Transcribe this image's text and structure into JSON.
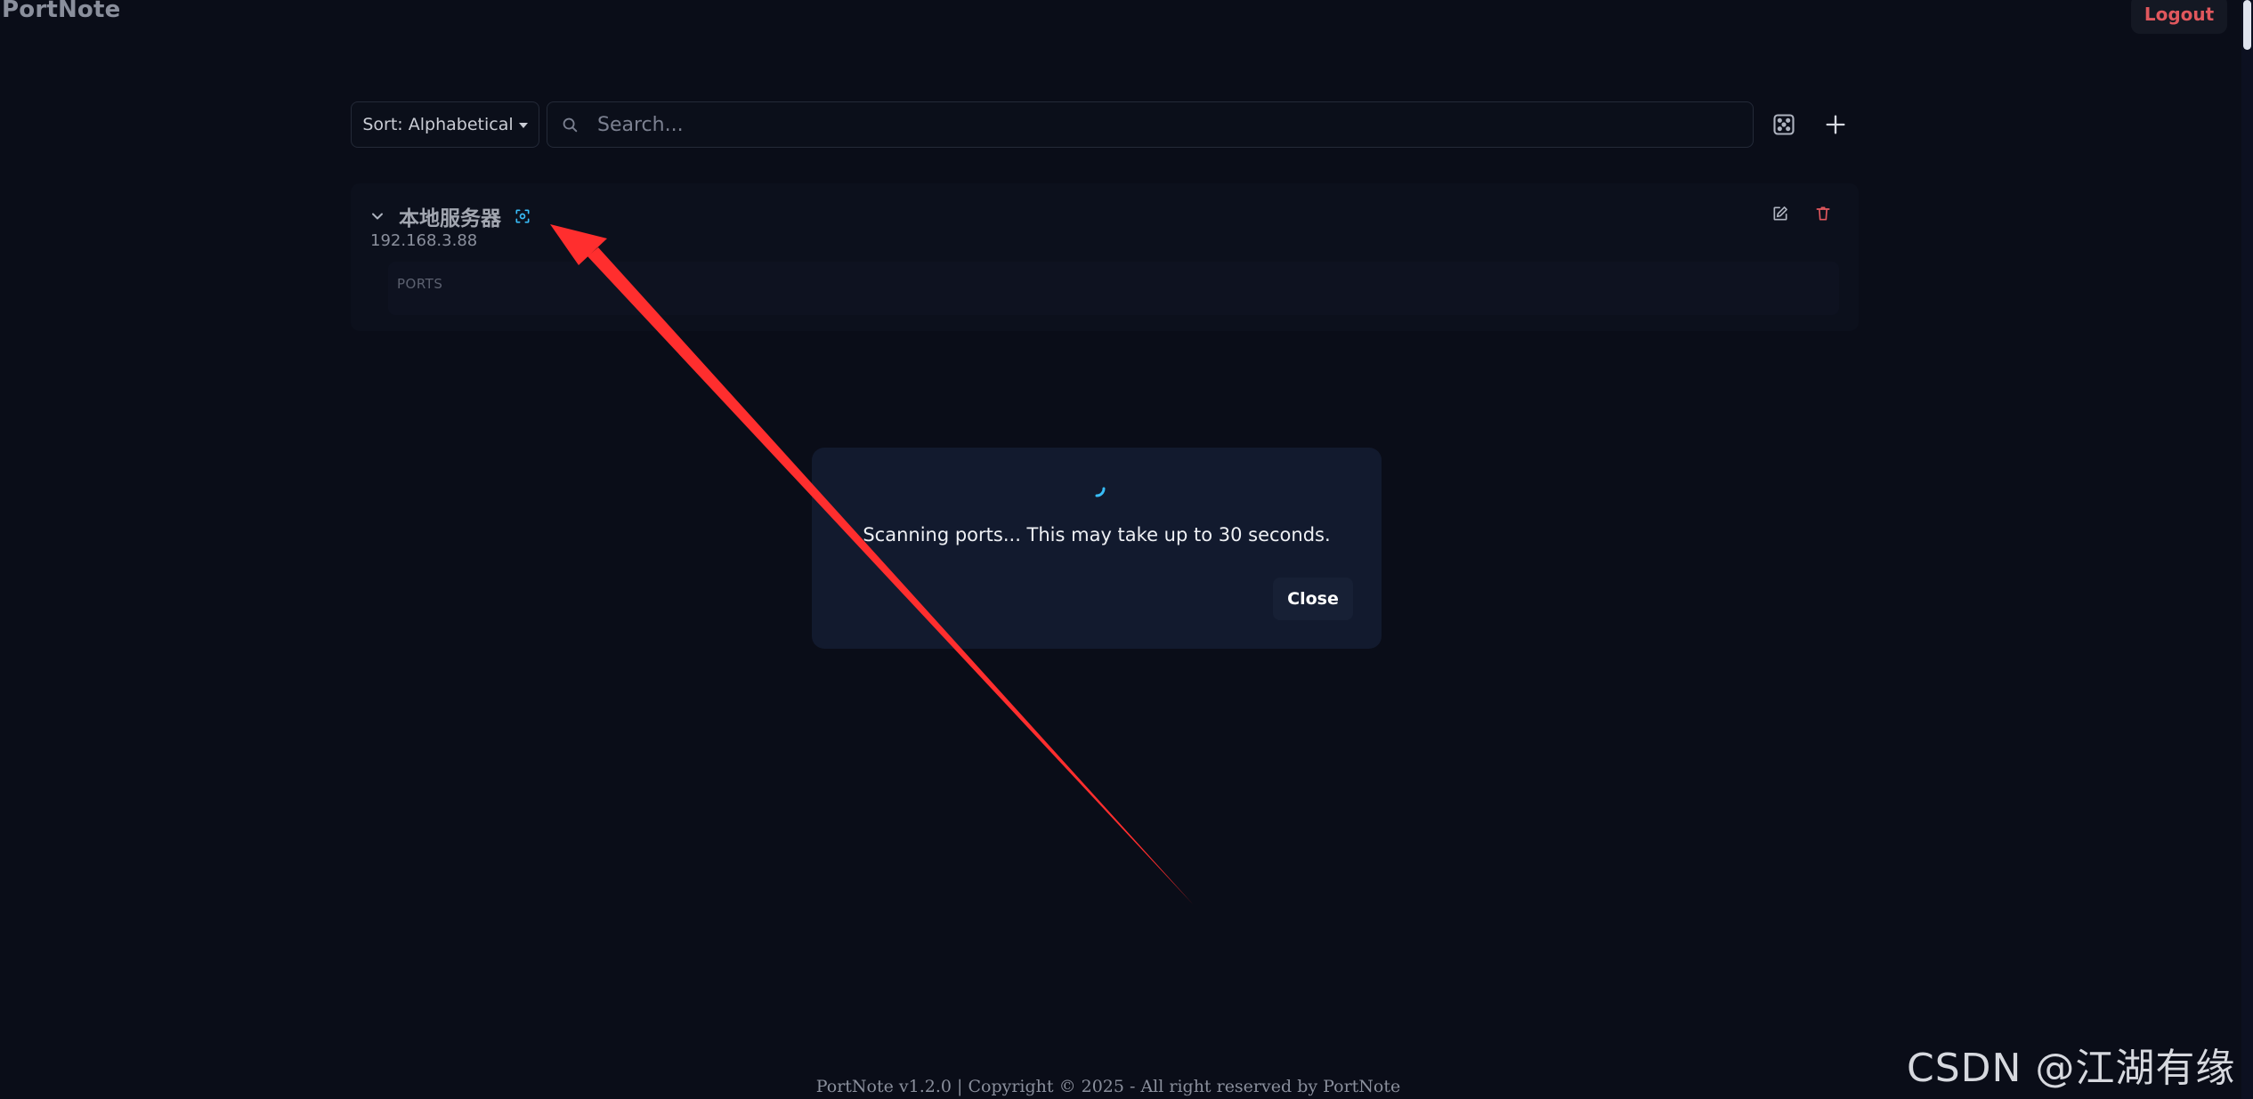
{
  "app": {
    "title": "PortNote",
    "logout_label": "Logout"
  },
  "toolbar": {
    "sort_label": "Sort: Alphabetical",
    "search_placeholder": "Search...",
    "random_icon": "dice-icon",
    "add_icon": "plus-icon"
  },
  "servers": [
    {
      "name": "本地服务器",
      "ip": "192.168.3.88",
      "ports_label": "PORTS",
      "icons": [
        "chevron-down-icon",
        "scan-icon",
        "edit-icon",
        "trash-icon"
      ]
    }
  ],
  "modal": {
    "message": "Scanning ports... This may take up to 30 seconds.",
    "close_label": "Close"
  },
  "footer": {
    "text": "PortNote v1.2.0 | Copyright © 2025 - All right reserved by PortNote"
  },
  "watermark": {
    "text": "CSDN @江湖有缘"
  },
  "colors": {
    "background": "#0a0d18",
    "accent": "#38bdf8",
    "danger": "#e0575d",
    "annotation": "#ff2e2e"
  }
}
